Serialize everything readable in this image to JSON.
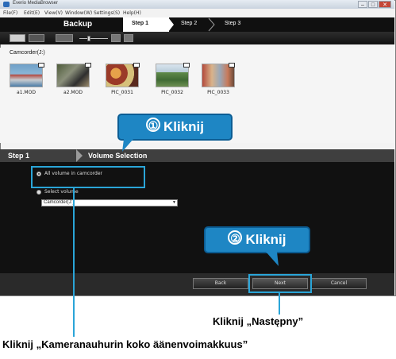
{
  "window": {
    "title": "Everio MediaBrowser",
    "controls": {
      "minimize": "–",
      "maximize": "□",
      "close": "✕"
    }
  },
  "menu": {
    "items": [
      "File(F)",
      "Edit(E)",
      "View(V)",
      "Window(W)",
      "Settings(S)",
      "Help(H)"
    ]
  },
  "header": {
    "title": "Backup",
    "steps": [
      "Step 1",
      "Step 2",
      "Step 3"
    ],
    "active_step": 0
  },
  "source": {
    "label": "Camcorder(J:)"
  },
  "thumbnails": [
    {
      "caption": "a1.MOD",
      "icon": "movie-icon"
    },
    {
      "caption": "a2.MOD",
      "icon": "movie-icon"
    },
    {
      "caption": "PIC_0031",
      "icon": "photo-icon"
    },
    {
      "caption": "PIC_0032",
      "icon": "photo-icon"
    },
    {
      "caption": "PIC_0033",
      "icon": "photo-icon"
    }
  ],
  "step_panel": {
    "step_label": "Step 1",
    "title": "Volume Selection"
  },
  "options": {
    "all_volume": "All volume in camcorder",
    "select_volume": "Select volume",
    "select_value": "Camcorder(J:)",
    "selected": "all_volume"
  },
  "footer": {
    "back": "Back",
    "next": "Next",
    "cancel": "Cancel"
  },
  "callouts": {
    "num1": "①",
    "num2": "②",
    "word": "Kliknij",
    "caption_next": "Kliknij „Następny”",
    "caption_volume": "Kliknij „Kameranauhurin koko äänenvoimakkuus”",
    "color": "#1e86c4"
  }
}
